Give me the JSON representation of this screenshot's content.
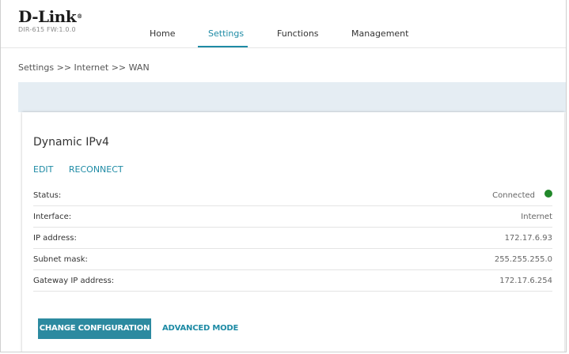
{
  "header": {
    "logo": "D-Link",
    "model": "DIR-615 FW:1.0.0",
    "nav": [
      {
        "label": "Home"
      },
      {
        "label": "Settings"
      },
      {
        "label": "Functions"
      },
      {
        "label": "Management"
      }
    ],
    "active_nav": "Settings"
  },
  "breadcrumb": "Settings >> Internet >> WAN",
  "card": {
    "title": "Dynamic IPv4",
    "actions": {
      "edit": "EDIT",
      "reconnect": "RECONNECT"
    },
    "rows": [
      {
        "label": "Status:",
        "value": "Connected"
      },
      {
        "label": "Interface:",
        "value": "Internet"
      },
      {
        "label": "IP address:",
        "value": "172.17.6.93"
      },
      {
        "label": "Subnet mask:",
        "value": "255.255.255.0"
      },
      {
        "label": "Gateway IP address:",
        "value": "172.17.6.254"
      }
    ],
    "buttons": {
      "change": "CHANGE CONFIGURATION",
      "advanced": "ADVANCED MODE"
    }
  },
  "colors": {
    "accent": "#1e8ba5",
    "status_ok": "#21882a",
    "band": "#e5edf3"
  }
}
